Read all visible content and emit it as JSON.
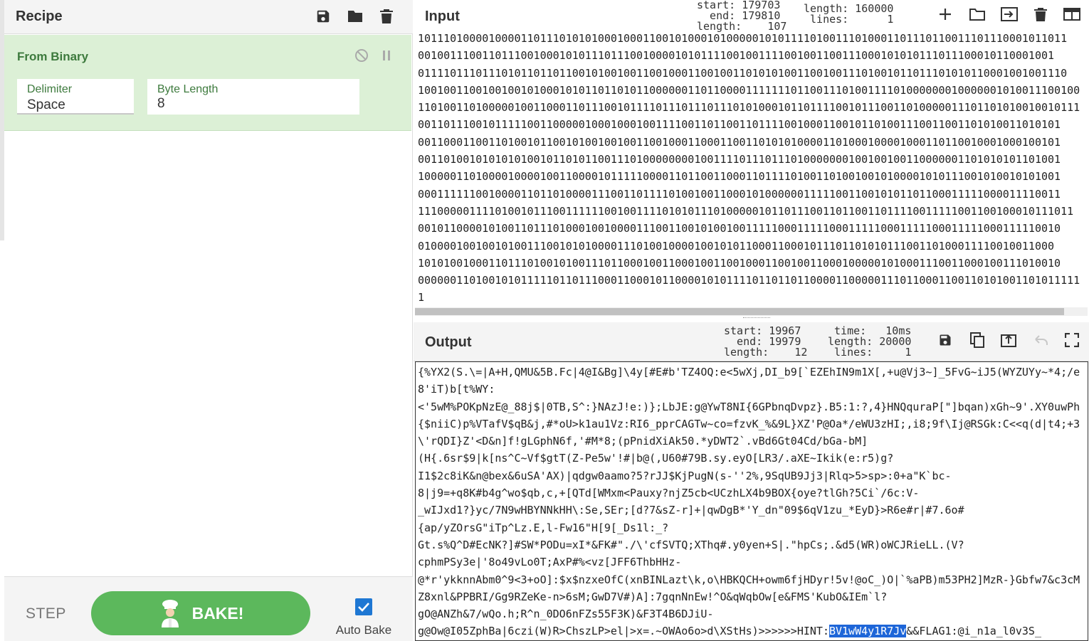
{
  "recipe": {
    "title": "Recipe",
    "icons": [
      "save-icon",
      "folder-icon",
      "trash-icon"
    ],
    "operation": {
      "name": "From Binary",
      "args": [
        {
          "label": "Delimiter",
          "value": "Space"
        },
        {
          "label": "Byte Length",
          "value": "8"
        }
      ]
    },
    "step_label": "STEP",
    "bake_label": "BAKE!",
    "auto_bake_label": "Auto Bake",
    "auto_bake_checked": true
  },
  "input": {
    "title": "Input",
    "stats_selection": "start: 179703\n  end: 179810\nlength:    107",
    "stats_totals": "length: 160000\n lines:      1",
    "lines": [
      "10111010000100001101110101010001000110010100010100000101011110100111010001101110110011101110001011011",
      "001001110011011100100010101110111001000010101111001001111001001100111000101010111011100010110001001",
      "01111011101110101101101100101001001100100011001001101010100110010011101001011011101010110001001001110",
      "1001001100100100101000101011011010110000001101100001111111011001110100111101000000010000001010011100100",
      "1101001101000001001100011011100101111011101110111010100010110111100101110011010000011101101010010010111",
      "0011011100101111100110000010001000100111100110110011011110010001100101101001110011001101010011010101",
      "0011000110011010010110010100100100110010001100011001101010100001101000100001000110110010001000100101",
      "0011010010101010100101101011001110100000000100111101110111010000000100100100110000001101010101101001",
      "1000001101000010000100110000101111100001101100110001101111010011010010010100001010111001010010101001",
      "0001111110010000110110100001110011011110100100110001010000001111100110010101101100011111000011110011",
      "111000001111010010111001111110010011110101011101000001011011100110110011011110011111001100100010111011",
      "0010110000101001101110100010010000111001100101001001111100011111000111110001111100011111000111110010",
      "010000100100101001110010101000011101001000010010101100011000101110110101011100110100011110010011000",
      "1010100100011011101001010011101100010011000100110010001100100110001000001010001110011000100111010010",
      "0000001101001010111110110111000110001011000010101111011011011000011000001110110001100110101001101011111",
      "1"
    ],
    "icons": [
      "plus-icon",
      "folder-icon",
      "import-icon",
      "trash-icon",
      "layout-icon"
    ]
  },
  "output": {
    "title": "Output",
    "stats_selection": "start: 19967\n  end: 19979\nlength:    12",
    "stats_totals": " time:   10ms\nlength: 20000\n lines:     1",
    "text_before": "{%YX2(S.\\=|A+H,QMU&5B.Fc|4@I&Bg]\\4y[#E#b'TZ4OQ:e<5wXj,DI_b9[`EZEhIN9m1X[,+u@Vj3~]_5FvG~iJ5(WYZUYy~*4;/e8'iT)b[t%WY:\n<'5wM%POKpNzE@_88j$|0TB,S^:}NAzJ!e:)};LbJE:g@YwT8NI{6GPbnqDvpz}.B5:1:?,4}HNQquraP[\"]bqan)xGh~9'.XY0uwPh{$niiC)p%VTafV$qB&j,#*oU>k1au1Vz:RI6_pprCAGTw~co=fzvK_%&9L}XZ'P@Oa*/eWU3zHI;,i8;9f\\Ij@RSGk:C<<q(d|t4;+3\\'rQDI}Z'<D&n]f!gLGphN6f,'#M*8;(pPnidXiAk50.*yDWT2`.vBd6Gt04Cd/bGa-bM]\n(H{.6sr$9|k[ns^C~Vf$gtT(Z-Pe5w'!#|b@(,U60#79B.sy.eyO[LR3/.aXE~Ikik(e:r5)g?\nI1$2c8iK&n@bex&6uSA'AX)|qdgw0aamo?5?rJJ$KjPugN(s-''2%,9SqUB9Jj3|Rlq>5>sp>:0+a\"K`bc-\n8|j9=+q8K#b4g^wo$qb,c,+[QTd[WMxm<Pauxy?njZ5cb<UCzhLX4b9BOX{oye?tlGh?5Ci`/6c:V-\n_wIJxd1?}yc/7N9wHBYNNkHH\\:Se,SEr;[d?7&sZ-r]+|qwDgB*'Y_dn\"09$6qV1zu_*EyD}>R6e#r|#7.6o#\n{ap/yZOrsG\"iTp^Lz.E,l-Fw16\"H[9[_Ds1l:_?\nGt.s%Q^D#EcNK?]#SW*PODu=xI*&FK#\"./\\'cfSVTQ;XThq#.y0yen+S|.\"hpCs;.&d5(WR)oWCJRieLL.(V?\ncphmPSy3e|'8o49vLo0T;AxP#%<vz[JFF6ThbHHz-\n@*r'ykknnAbm0^9<3+oO]:$x$nzxeOfC(xnBINLazt\\k,o\\HBKQCH+owm6fjHDyr!5v!@oC_)O|`%aPB)m53PH2]MzR-}Gbfw7&c3cMZ8xnl&PPBRI/Gg9RZeKe-n>6sM;GwD7V#)A]:7gqnNnEw!^O&qWqbOw[e&FMS'KubO&IEm`l?\ngO@ANZh&7/wQo.h;R^n_0DO6nFZs55F3K)&F3T4B6DJiU-\ng@Ow@I05ZphBa|6czi(W)R>ChszLP>el|>x=.~OWAo6o>d\\XStHs)>>>>>>HINT:",
    "highlight": "BV1wW4y1R7Jv",
    "text_after": "&&FLAG1:@i_n1a_l0v3S_",
    "icons": [
      "save-icon",
      "copy-icon",
      "replace-input-icon",
      "undo-icon",
      "maximise-icon"
    ]
  }
}
